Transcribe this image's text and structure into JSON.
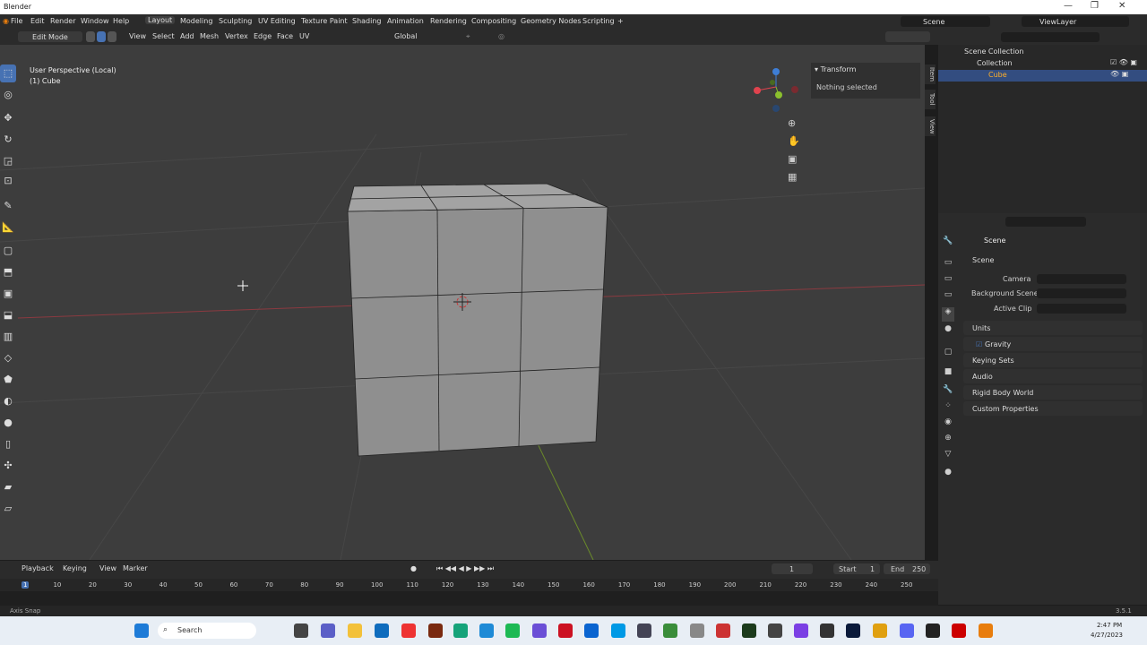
{
  "window": {
    "title": "Blender"
  },
  "menu": [
    "File",
    "Edit",
    "Render",
    "Window",
    "Help"
  ],
  "workspaces": [
    "Layout",
    "Modeling",
    "Sculpting",
    "UV Editing",
    "Texture Paint",
    "Shading",
    "Animation",
    "Rendering",
    "Compositing",
    "Geometry Nodes",
    "Scripting"
  ],
  "scene_label": "Scene",
  "viewlayer_label": "ViewLayer",
  "header": {
    "mode": "Edit Mode",
    "view": "View",
    "select": "Select",
    "add": "Add",
    "mesh": "Mesh",
    "vertex": "Vertex",
    "edge": "Edge",
    "face": "Face",
    "uv": "UV",
    "orientation": "Global",
    "options": "Options",
    "x": "X",
    "y": "Y",
    "z": "Z"
  },
  "viewport": {
    "perspective": "User Perspective (Local)",
    "object": "(1) Cube"
  },
  "npanel": {
    "section": "Transform",
    "message": "Nothing selected",
    "tabs": [
      "Item",
      "Tool",
      "View"
    ]
  },
  "outliner": {
    "root": "Scene Collection",
    "collection": "Collection",
    "object": "Cube"
  },
  "properties": {
    "title": "Scene",
    "section": "Scene",
    "camera_label": "Camera",
    "bg_label": "Background Scene",
    "clip_label": "Active Clip",
    "panels": [
      "Units",
      "Gravity",
      "Keying Sets",
      "Audio",
      "Rigid Body World",
      "Custom Properties"
    ]
  },
  "timeline": {
    "playback": "Playback",
    "keying": "Keying",
    "view": "View",
    "marker": "Marker",
    "current": "1",
    "start_label": "Start",
    "start": "1",
    "end_label": "End",
    "end": "250",
    "ticks": [
      "1",
      "10",
      "20",
      "30",
      "40",
      "50",
      "60",
      "70",
      "80",
      "90",
      "100",
      "110",
      "120",
      "130",
      "140",
      "150",
      "160",
      "170",
      "180",
      "190",
      "200",
      "210",
      "220",
      "230",
      "240",
      "250"
    ]
  },
  "status": {
    "left": "Axis Snap",
    "version": "3.5.1"
  },
  "taskbar": {
    "search": "Search",
    "time": "2:47 PM",
    "date": "4/27/2023"
  },
  "colors": {
    "accent": "#4772b3",
    "selected": "#ffaf29",
    "x_axis": "#e0434e",
    "y_axis": "#8bc02d",
    "z_axis": "#3e7ed6"
  }
}
